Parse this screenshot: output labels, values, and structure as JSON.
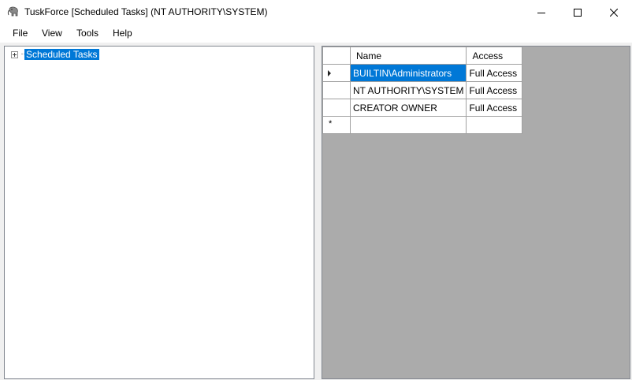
{
  "window": {
    "title": "TuskForce [Scheduled Tasks] (NT AUTHORITY\\SYSTEM)",
    "icon": "elephant-app-icon"
  },
  "menubar": {
    "items": [
      "File",
      "View",
      "Tools",
      "Help"
    ]
  },
  "tree": {
    "root_label": "Scheduled Tasks",
    "root_selected": true,
    "root_collapsed": true
  },
  "grid": {
    "columns": [
      "Name",
      "Access"
    ],
    "rows": [
      {
        "name": "BUILTIN\\Administrators",
        "access": "Full Access",
        "current": true,
        "name_selected": true
      },
      {
        "name": "NT AUTHORITY\\SYSTEM",
        "access": "Full Access",
        "current": false,
        "name_selected": false
      },
      {
        "name": "CREATOR OWNER",
        "access": "Full Access",
        "current": false,
        "name_selected": false
      }
    ],
    "new_row_marker": "*"
  },
  "colors": {
    "selection": "#0078d7",
    "grid_background": "#ababab"
  }
}
